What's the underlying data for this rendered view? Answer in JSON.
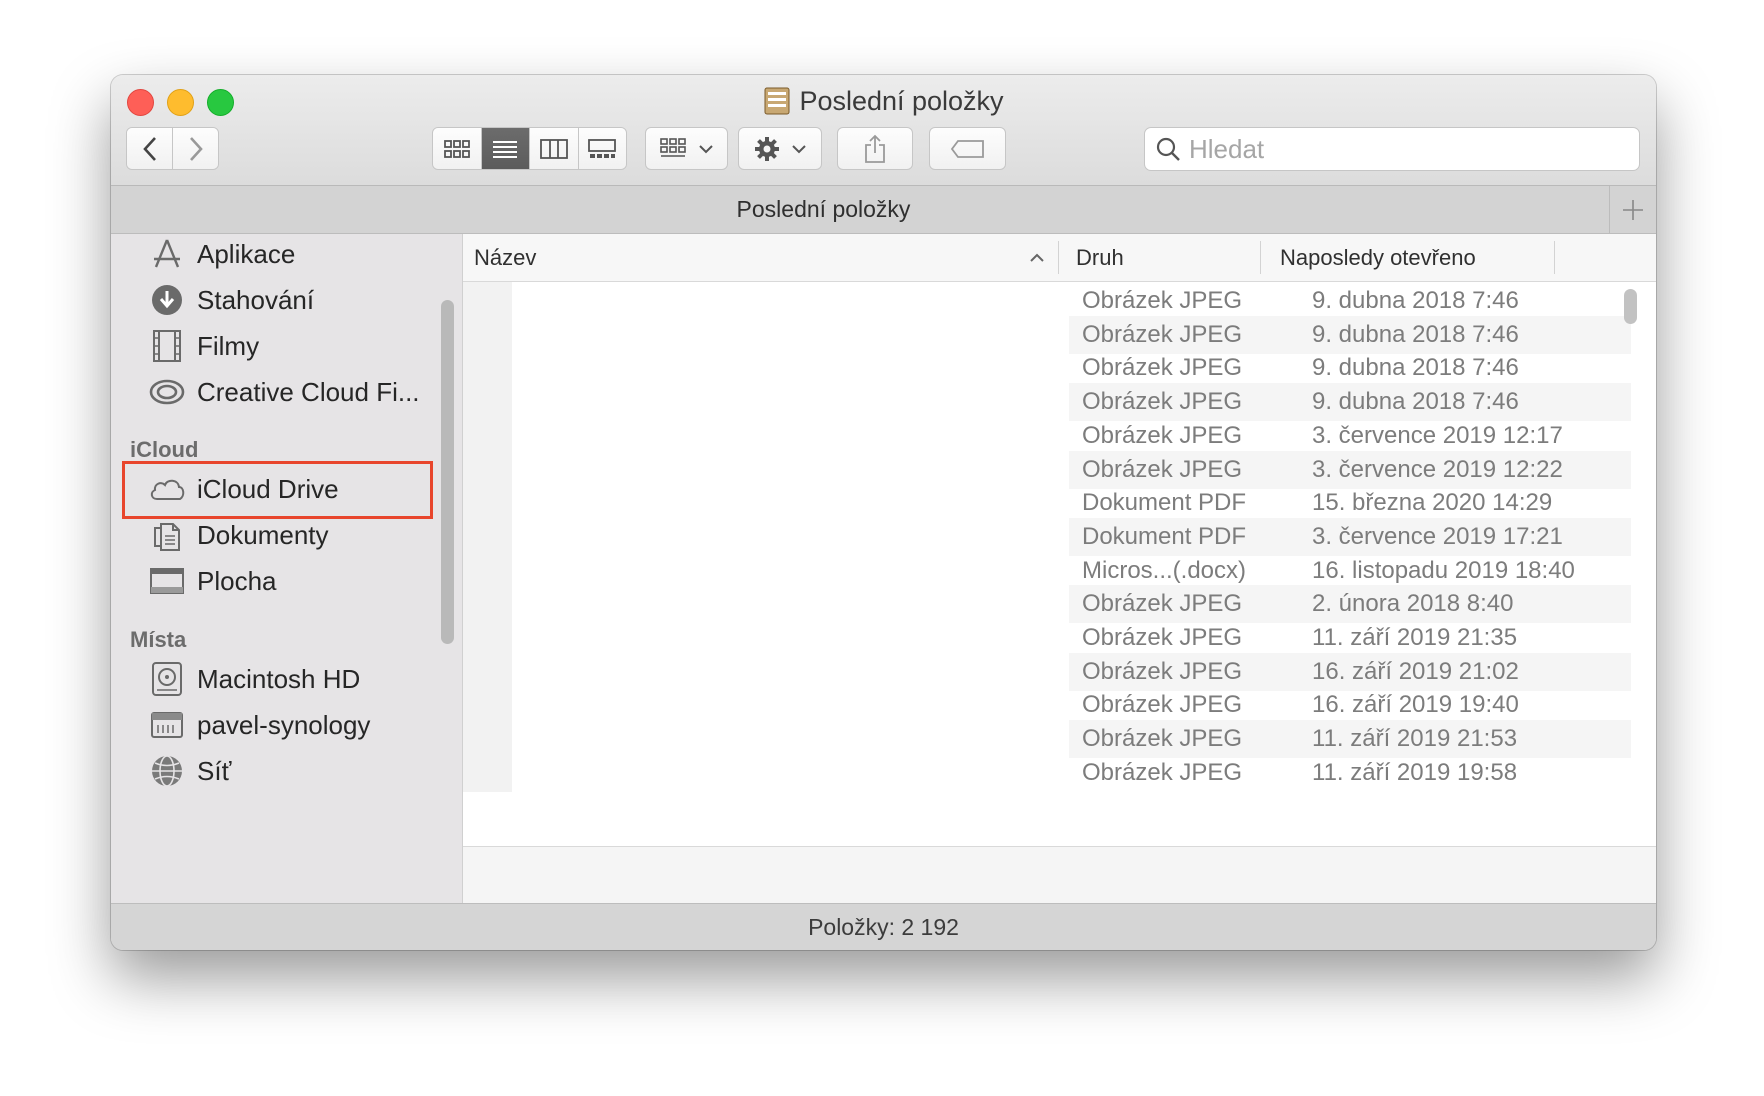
{
  "window": {
    "title": "Poslední položky",
    "tab_label": "Poslední položky",
    "status": "Položky: 2 192"
  },
  "toolbar": {
    "search_placeholder": "Hledat"
  },
  "sidebar": {
    "favorites": [
      {
        "label": "Aplikace",
        "icon": "apps-icon"
      },
      {
        "label": "Stahování",
        "icon": "download-icon"
      },
      {
        "label": "Filmy",
        "icon": "film-icon"
      },
      {
        "label": "Creative Cloud Fi...",
        "icon": "creative-cloud-icon"
      }
    ],
    "icloud_header": "iCloud",
    "icloud": [
      {
        "label": "iCloud Drive",
        "icon": "cloud-icon"
      },
      {
        "label": "Dokumenty",
        "icon": "documents-icon"
      },
      {
        "label": "Plocha",
        "icon": "desktop-icon"
      }
    ],
    "places_header": "Místa",
    "places": [
      {
        "label": "Macintosh HD",
        "icon": "disk-icon"
      },
      {
        "label": "pavel-synology",
        "icon": "server-icon"
      },
      {
        "label": "Síť",
        "icon": "network-icon"
      }
    ]
  },
  "list": {
    "columns": {
      "name": "Název",
      "kind": "Druh",
      "date": "Naposledy otevřeno"
    },
    "rows": [
      {
        "kind": "Obrázek JPEG",
        "date": "9. dubna 2018 7:46"
      },
      {
        "kind": "Obrázek JPEG",
        "date": "9. dubna 2018 7:46"
      },
      {
        "kind": "Obrázek JPEG",
        "date": "9. dubna 2018 7:46"
      },
      {
        "kind": "Obrázek JPEG",
        "date": "9. dubna 2018 7:46"
      },
      {
        "kind": "Obrázek JPEG",
        "date": "3. července 2019 12:17"
      },
      {
        "kind": "Obrázek JPEG",
        "date": "3. července 2019 12:22"
      },
      {
        "kind": "Dokument PDF",
        "date": "15. března 2020 14:29"
      },
      {
        "kind": "Dokument PDF",
        "date": "3. července 2019 17:21"
      },
      {
        "kind": "Micros...(.docx)",
        "date": "16. listopadu 2019 18:40"
      },
      {
        "kind": "Obrázek JPEG",
        "date": "2. února 2018 8:40"
      },
      {
        "kind": "Obrázek JPEG",
        "date": "11. září 2019 21:35"
      },
      {
        "kind": "Obrázek JPEG",
        "date": "16. září 2019 21:02"
      },
      {
        "kind": "Obrázek JPEG",
        "date": "16. září 2019 19:40"
      },
      {
        "kind": "Obrázek JPEG",
        "date": "11. září 2019 21:53"
      },
      {
        "kind": "Obrázek JPEG",
        "date": "11. září 2019 19:58"
      }
    ]
  }
}
